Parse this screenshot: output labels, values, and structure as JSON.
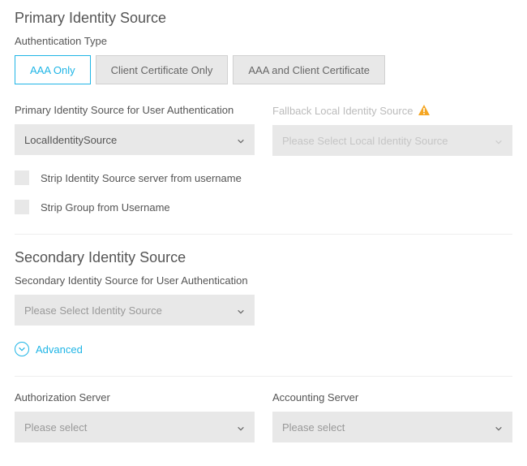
{
  "primary": {
    "title": "Primary Identity Source",
    "authTypeLabel": "Authentication Type",
    "authOptions": {
      "aaaOnly": "AAA Only",
      "clientCertOnly": "Client Certificate Only",
      "aaaAndClientCert": "AAA and Client Certificate"
    },
    "sourceLabel": "Primary Identity Source for User Authentication",
    "sourceValue": "LocalIdentitySource",
    "fallbackLabel": "Fallback Local Identity Source",
    "fallbackPlaceholder": "Please Select Local Identity Source",
    "stripServer": "Strip Identity Source server from username",
    "stripGroup": "Strip Group from Username"
  },
  "secondary": {
    "title": "Secondary Identity Source",
    "sourceLabel": "Secondary Identity Source for User Authentication",
    "sourcePlaceholder": "Please Select Identity Source",
    "advanced": "Advanced"
  },
  "authorization": {
    "label": "Authorization Server",
    "placeholder": "Please select"
  },
  "accounting": {
    "label": "Accounting Server",
    "placeholder": "Please select"
  }
}
